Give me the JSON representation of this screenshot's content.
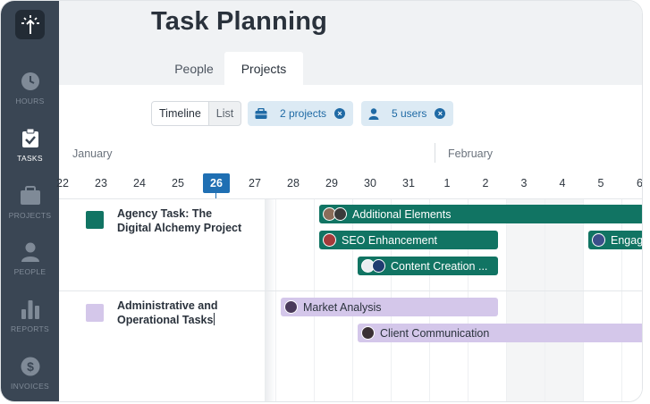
{
  "app": {
    "title": "Task Planning",
    "tabs": [
      {
        "label": "People",
        "active": false
      },
      {
        "label": "Projects",
        "active": true
      }
    ]
  },
  "sidebar": {
    "items": [
      {
        "label": "HOURS",
        "icon": "clock-icon",
        "active": false
      },
      {
        "label": "TASKS",
        "icon": "clipboard-check-icon",
        "active": true
      },
      {
        "label": "PROJECTS",
        "icon": "briefcase-icon",
        "active": false
      },
      {
        "label": "PEOPLE",
        "icon": "person-icon",
        "active": false
      },
      {
        "label": "REPORTS",
        "icon": "bar-chart-icon",
        "active": false
      },
      {
        "label": "INVOICES",
        "icon": "dollar-icon",
        "active": false
      }
    ]
  },
  "toolbar": {
    "view_options": [
      "Timeline",
      "List"
    ],
    "selected_view": "Timeline",
    "filters": [
      {
        "label": "2 projects",
        "icon": "briefcase-icon"
      },
      {
        "label": "5 users",
        "icon": "person-icon"
      }
    ]
  },
  "timeline": {
    "months": [
      "January",
      "February"
    ],
    "days": [
      "22",
      "23",
      "24",
      "25",
      "26",
      "27",
      "28",
      "29",
      "30",
      "31",
      "1",
      "2",
      "3",
      "4",
      "5",
      "6"
    ],
    "today": "26"
  },
  "rows": [
    {
      "title_line1": "Agency Task: The",
      "title_line2": "Digital Alchemy Project",
      "color": "#117463",
      "tasks": [
        "Additional Elements",
        "SEO Enhancement",
        "Engag",
        "Content Creation ..."
      ]
    },
    {
      "title_line1": "Administrative and",
      "title_line2": "Operational Tasks",
      "color": "#d4c7ea",
      "tasks": [
        "Market Analysis",
        "Client Communication"
      ]
    }
  ],
  "colors": {
    "sidebar": "#3a4654",
    "accent_blue": "#1f6fb3",
    "green_bar": "#117463",
    "purple_bar": "#d4c7ea"
  }
}
